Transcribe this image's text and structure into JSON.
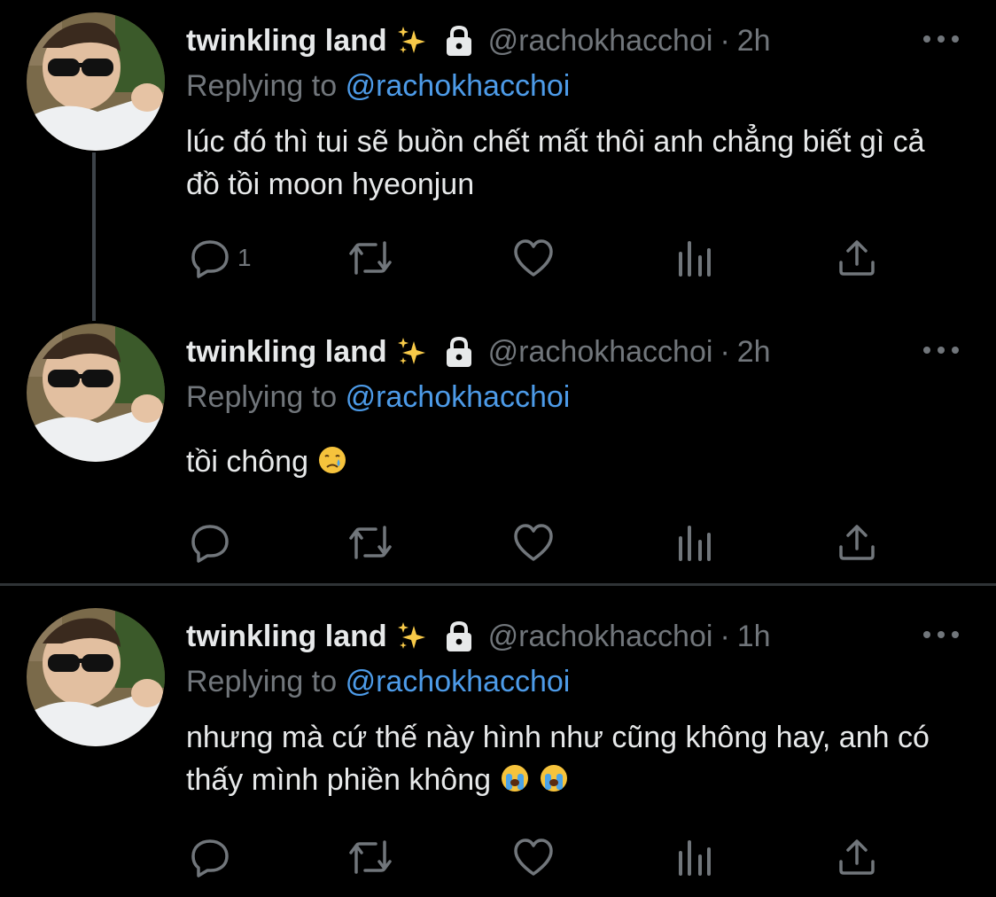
{
  "tweets": [
    {
      "display_name": "twinkling land",
      "handle": "@rachokhacchoi",
      "separator": "·",
      "time": "2h",
      "replying_prefix": "Replying to",
      "replying_handle": "@rachokhacchoi",
      "text": "lúc đó thì tui sẽ buồn chết mất thôi anh chẳng biết gì cả đồ tồi moon hyeonjun",
      "text_emojis": [],
      "reply_count": "1"
    },
    {
      "display_name": "twinkling land",
      "handle": "@rachokhacchoi",
      "separator": "·",
      "time": "2h",
      "replying_prefix": "Replying to",
      "replying_handle": "@rachokhacchoi",
      "text": "tồi chông",
      "text_emojis": [
        "crying-face-emoji"
      ],
      "reply_count": ""
    },
    {
      "display_name": "twinkling land",
      "handle": "@rachokhacchoi",
      "separator": "·",
      "time": "1h",
      "replying_prefix": "Replying to",
      "replying_handle": "@rachokhacchoi",
      "text": "nhưng mà cứ thế này hình như cũng không hay, anh có thấy mình phiền không",
      "text_emojis": [
        "loudly-crying-face-emoji",
        "loudly-crying-face-emoji"
      ],
      "reply_count": ""
    }
  ],
  "icons": {
    "name_badges": [
      "sparkles-icon",
      "lock-icon"
    ],
    "overflow": "more-icon",
    "actions": [
      "reply-icon",
      "retweet-icon",
      "like-icon",
      "views-icon",
      "share-icon"
    ]
  },
  "colors": {
    "background": "#000000",
    "primary_text": "#e7e9ea",
    "secondary_text": "#71767b",
    "mention": "#4d9be8",
    "divider": "#2f3336",
    "thread_line": "#3d4349"
  }
}
